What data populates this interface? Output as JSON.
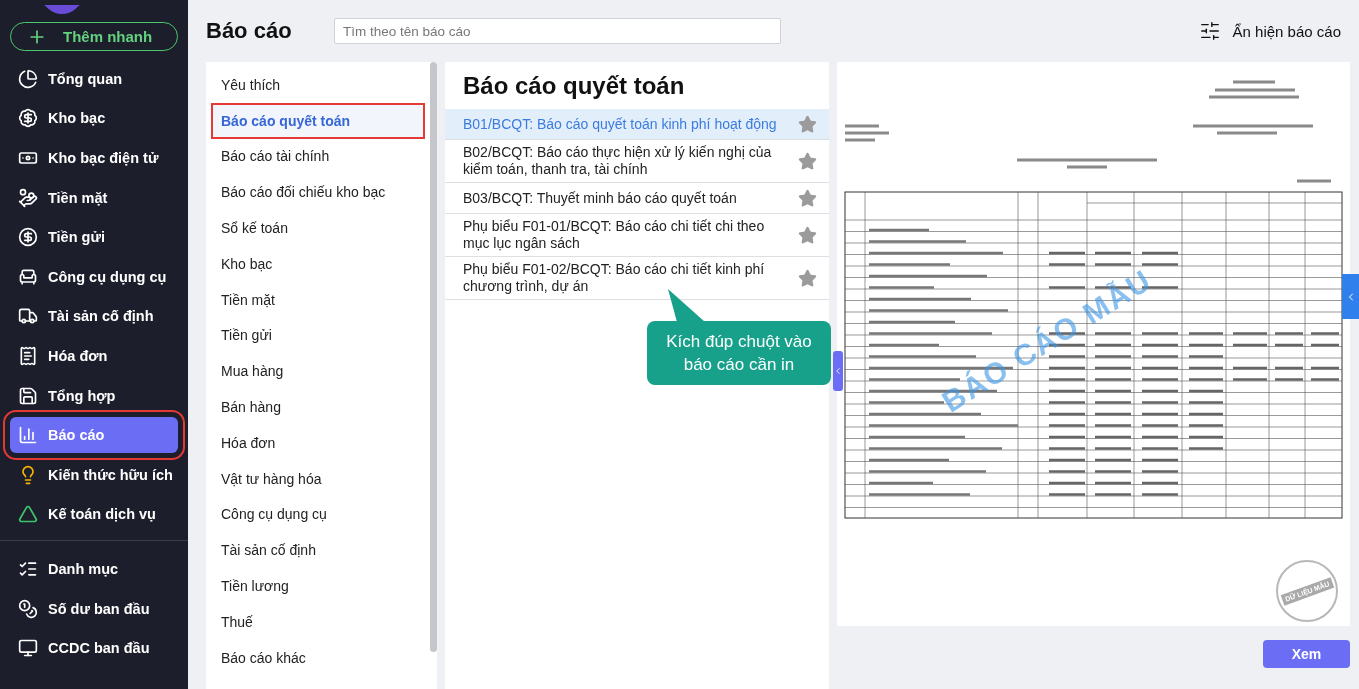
{
  "sidebar": {
    "quick_add": "Thêm nhanh",
    "groups": [
      {
        "items": [
          {
            "label": "Tổng quan",
            "selected": false,
            "highlighted": false
          },
          {
            "label": "Kho bạc",
            "selected": false,
            "highlighted": false
          },
          {
            "label": "Kho bạc điện tử",
            "selected": false,
            "highlighted": false
          },
          {
            "label": "Tiền mặt",
            "selected": false,
            "highlighted": false
          },
          {
            "label": "Tiền gửi",
            "selected": false,
            "highlighted": false
          },
          {
            "label": "Công cụ dụng cụ",
            "selected": false,
            "highlighted": false
          },
          {
            "label": "Tài sản cố định",
            "selected": false,
            "highlighted": false
          },
          {
            "label": "Hóa đơn",
            "selected": false,
            "highlighted": false
          },
          {
            "label": "Tổng hợp",
            "selected": false,
            "highlighted": false
          },
          {
            "label": "Báo cáo",
            "selected": true,
            "highlighted": true
          },
          {
            "label": "Kiến thức hữu ích",
            "selected": false,
            "highlighted": false
          },
          {
            "label": "Kế toán dịch vụ",
            "selected": false,
            "highlighted": false
          }
        ]
      },
      {
        "items": [
          {
            "label": "Danh mục",
            "selected": false,
            "highlighted": false
          },
          {
            "label": "Số dư ban đầu",
            "selected": false,
            "highlighted": false
          },
          {
            "label": "CCDC ban đầu",
            "selected": false,
            "highlighted": false
          }
        ]
      }
    ]
  },
  "header": {
    "title": "Báo cáo",
    "search": {
      "placeholder": "Tìm theo tên báo cáo"
    },
    "toggle_button": "Ẩn hiện báo cáo"
  },
  "categories": [
    {
      "label": "Yêu thích",
      "selected": false,
      "highlighted": false
    },
    {
      "label": "Báo cáo quyết toán",
      "selected": true,
      "highlighted": true
    },
    {
      "label": "Báo cáo tài chính",
      "selected": false,
      "highlighted": false
    },
    {
      "label": "Báo cáo đối chiếu kho bạc",
      "selected": false,
      "highlighted": false
    },
    {
      "label": "Sổ kế toán",
      "selected": false,
      "highlighted": false
    },
    {
      "label": "Kho bạc",
      "selected": false,
      "highlighted": false
    },
    {
      "label": "Tiền mặt",
      "selected": false,
      "highlighted": false
    },
    {
      "label": "Tiền gửi",
      "selected": false,
      "highlighted": false
    },
    {
      "label": "Mua hàng",
      "selected": false,
      "highlighted": false
    },
    {
      "label": "Bán hàng",
      "selected": false,
      "highlighted": false
    },
    {
      "label": "Hóa đơn",
      "selected": false,
      "highlighted": false
    },
    {
      "label": "Vật tư hàng hóa",
      "selected": false,
      "highlighted": false
    },
    {
      "label": "Công cụ dụng cụ",
      "selected": false,
      "highlighted": false
    },
    {
      "label": "Tài sản cố định",
      "selected": false,
      "highlighted": false
    },
    {
      "label": "Tiền lương",
      "selected": false,
      "highlighted": false
    },
    {
      "label": "Thuế",
      "selected": false,
      "highlighted": false
    },
    {
      "label": "Báo cáo khác",
      "selected": false,
      "highlighted": false
    }
  ],
  "reports": {
    "title": "Báo cáo quyết toán",
    "items": [
      {
        "label": "B01/BCQT: Báo cáo quyết toán kinh phí hoạt động",
        "selected": true
      },
      {
        "label": "B02/BCQT: Báo cáo thực hiện xử lý kiến nghị của kiểm toán, thanh tra, tài chính",
        "selected": false
      },
      {
        "label": "B03/BCQT: Thuyết minh báo cáo quyết toán",
        "selected": false
      },
      {
        "label": "Phụ biểu F01-01/BCQT: Báo cáo chi tiết chi theo mục lục ngân sách",
        "selected": false
      },
      {
        "label": "Phụ biểu F01-02/BCQT: Báo cáo chi tiết kinh phí chương trình, dự án",
        "selected": false
      }
    ],
    "hint": "Kích đúp chuột vào báo cáo cần in"
  },
  "preview": {
    "watermark": "BÁO CÁO MẪU",
    "stamp": "DỮ LIỆU MẪU"
  },
  "view_button": "Xem"
}
